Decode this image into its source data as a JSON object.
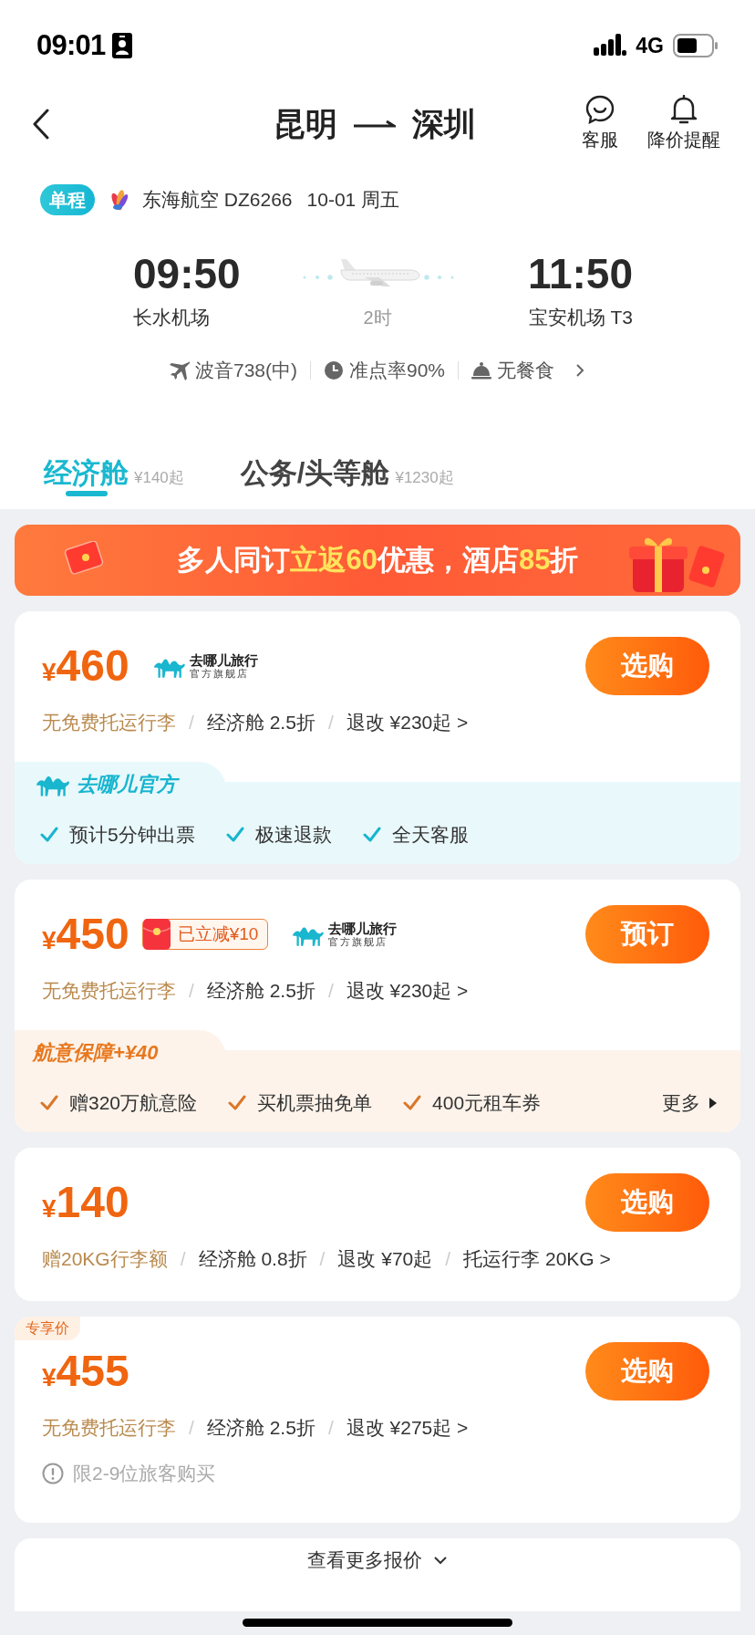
{
  "status_bar": {
    "time": "09:01",
    "network": "4G"
  },
  "nav": {
    "from": "昆明",
    "to": "深圳",
    "actions": [
      {
        "kind": "service",
        "label": "客服"
      },
      {
        "kind": "alert",
        "label": "降价提醒"
      }
    ]
  },
  "flight": {
    "trip_type": "单程",
    "airline": "东海航空 DZ6266",
    "date": "10-01 周五",
    "depart_time": "09:50",
    "depart_airport": "长水机场",
    "duration": "2时",
    "arrive_time": "11:50",
    "arrive_airport": "宝安机场 T3",
    "details": [
      {
        "kind": "aircraft",
        "text": "波音738(中)"
      },
      {
        "kind": "punctuality",
        "text": "准点率90%"
      },
      {
        "kind": "meal",
        "text": "无餐食"
      }
    ]
  },
  "cabin_tabs": [
    {
      "label": "经济舱",
      "price": "¥140起",
      "selected": true
    },
    {
      "label": "公务/头等舱",
      "price": "¥1230起",
      "selected": false
    }
  ],
  "banner": {
    "segments": [
      {
        "text": "多人同订",
        "highlight": false
      },
      {
        "text": "立返60",
        "highlight": true
      },
      {
        "text": "优惠，酒店",
        "highlight": false
      },
      {
        "text": "85",
        "highlight": true
      },
      {
        "text": "折",
        "highlight": false
      }
    ]
  },
  "offers": [
    {
      "currency": "¥",
      "amount": "460",
      "vendor": {
        "name": "去哪儿旅行",
        "sub": "官方旗舰店"
      },
      "button": "选购",
      "features": [
        {
          "kind": "highlight",
          "text": "无免费托运行李"
        },
        {
          "kind": "separator",
          "text": "/"
        },
        {
          "kind": "plain",
          "text": "经济舱 2.5折"
        },
        {
          "kind": "separator",
          "text": "/"
        },
        {
          "kind": "plain",
          "text": "退改 ¥230起 >"
        }
      ],
      "perks": {
        "kind": "official",
        "title": "去哪儿官方",
        "items": [
          "预计5分钟出票",
          "极速退款",
          "全天客服"
        ]
      }
    },
    {
      "currency": "¥",
      "amount": "450",
      "discount": "已立减¥10",
      "vendor": {
        "name": "去哪儿旅行",
        "sub": "官方旗舰店"
      },
      "button": "预订",
      "features": [
        {
          "kind": "highlight",
          "text": "无免费托运行李"
        },
        {
          "kind": "separator",
          "text": "/"
        },
        {
          "kind": "plain",
          "text": "经济舱 2.5折"
        },
        {
          "kind": "separator",
          "text": "/"
        },
        {
          "kind": "plain",
          "text": "退改 ¥230起 >"
        }
      ],
      "perks": {
        "kind": "insurance",
        "title": "航意保障+¥40",
        "items": [
          "赠320万航意险",
          "买机票抽免单",
          "400元租车券"
        ],
        "more": "更多"
      }
    },
    {
      "currency": "¥",
      "amount": "140",
      "button": "选购",
      "features": [
        {
          "kind": "highlight",
          "text": "赠20KG行李额"
        },
        {
          "kind": "separator",
          "text": "/"
        },
        {
          "kind": "plain",
          "text": "经济舱 0.8折"
        },
        {
          "kind": "separator",
          "text": "/"
        },
        {
          "kind": "plain",
          "text": "退改 ¥70起"
        },
        {
          "kind": "separator",
          "text": "/"
        },
        {
          "kind": "plain",
          "text": "托运行李 20KG >"
        }
      ]
    },
    {
      "tag": "专享价",
      "currency": "¥",
      "amount": "455",
      "button": "选购",
      "features": [
        {
          "kind": "highlight",
          "text": "无免费托运行李"
        },
        {
          "kind": "separator",
          "text": "/"
        },
        {
          "kind": "plain",
          "text": "经济舱 2.5折"
        },
        {
          "kind": "separator",
          "text": "/"
        },
        {
          "kind": "plain",
          "text": "退改 ¥275起 >"
        }
      ],
      "notice": "限2-9位旅客购买"
    }
  ],
  "more_quotes": "查看更多报价"
}
